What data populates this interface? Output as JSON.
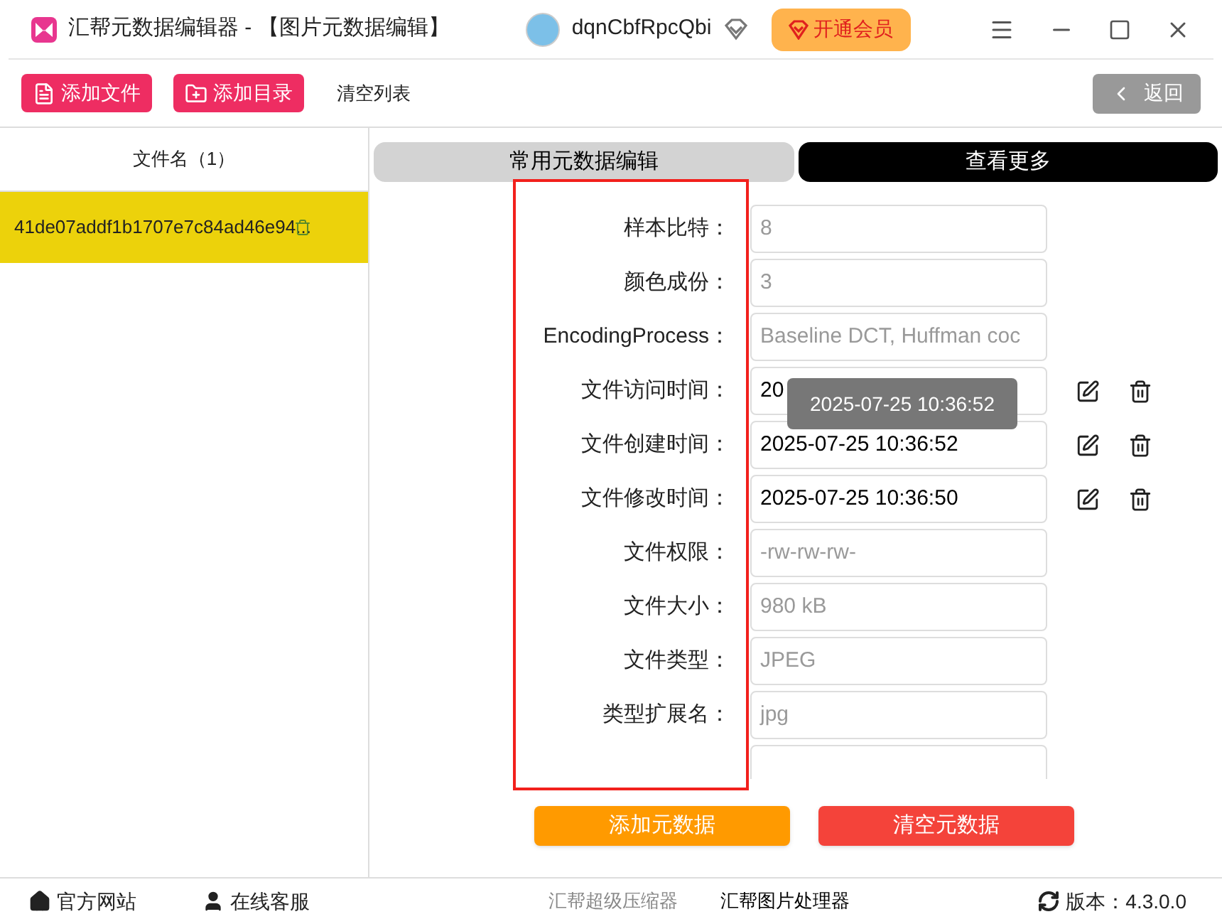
{
  "window": {
    "title": "汇帮元数据编辑器 - 【图片元数据编辑】",
    "username": "dqnCbfRpcQbi",
    "vip_button": "开通会员"
  },
  "toolbar": {
    "buttons": [
      "添加文件",
      "添加目录"
    ],
    "clear_link": "清空列表",
    "back_button": "返回"
  },
  "file_list": {
    "header": "文件名（1）",
    "items": [
      {
        "name": "41de07addf1b1707e7c84ad46e94...",
        "selected": true
      }
    ]
  },
  "tabs": [
    {
      "label": "常用元数据编辑",
      "selected": false
    },
    {
      "label": "查看更多",
      "selected": true
    }
  ],
  "fields": [
    {
      "label": "样本比特：",
      "value": "8",
      "editable": false
    },
    {
      "label": "颜色成份：",
      "value": "3",
      "editable": false
    },
    {
      "label": "EncodingProcess：",
      "value": "Baseline DCT, Huffman coc",
      "editable": false
    },
    {
      "label": "文件访问时间：",
      "value": "20",
      "editable": true
    },
    {
      "label": "文件创建时间：",
      "value": "2025-07-25 10:36:52",
      "editable": true
    },
    {
      "label": "文件修改时间：",
      "value": "2025-07-25 10:36:50",
      "editable": true
    },
    {
      "label": "文件权限：",
      "value": "-rw-rw-rw-",
      "editable": false
    },
    {
      "label": "文件大小：",
      "value": "980 kB",
      "editable": false
    },
    {
      "label": "文件类型：",
      "value": "JPEG",
      "editable": false
    },
    {
      "label": "类型扩展名：",
      "value": "jpg",
      "editable": false
    }
  ],
  "tooltip": "2025-07-25 10:36:52",
  "actions": [
    "添加元数据",
    "清空元数据"
  ],
  "footer": {
    "links": [
      "官方网站",
      "在线客服"
    ],
    "products": [
      {
        "label": "汇帮超级压缩器",
        "selected": false
      },
      {
        "label": "汇帮图片处理器",
        "selected": true
      }
    ],
    "version": "版本：4.3.0.0"
  }
}
